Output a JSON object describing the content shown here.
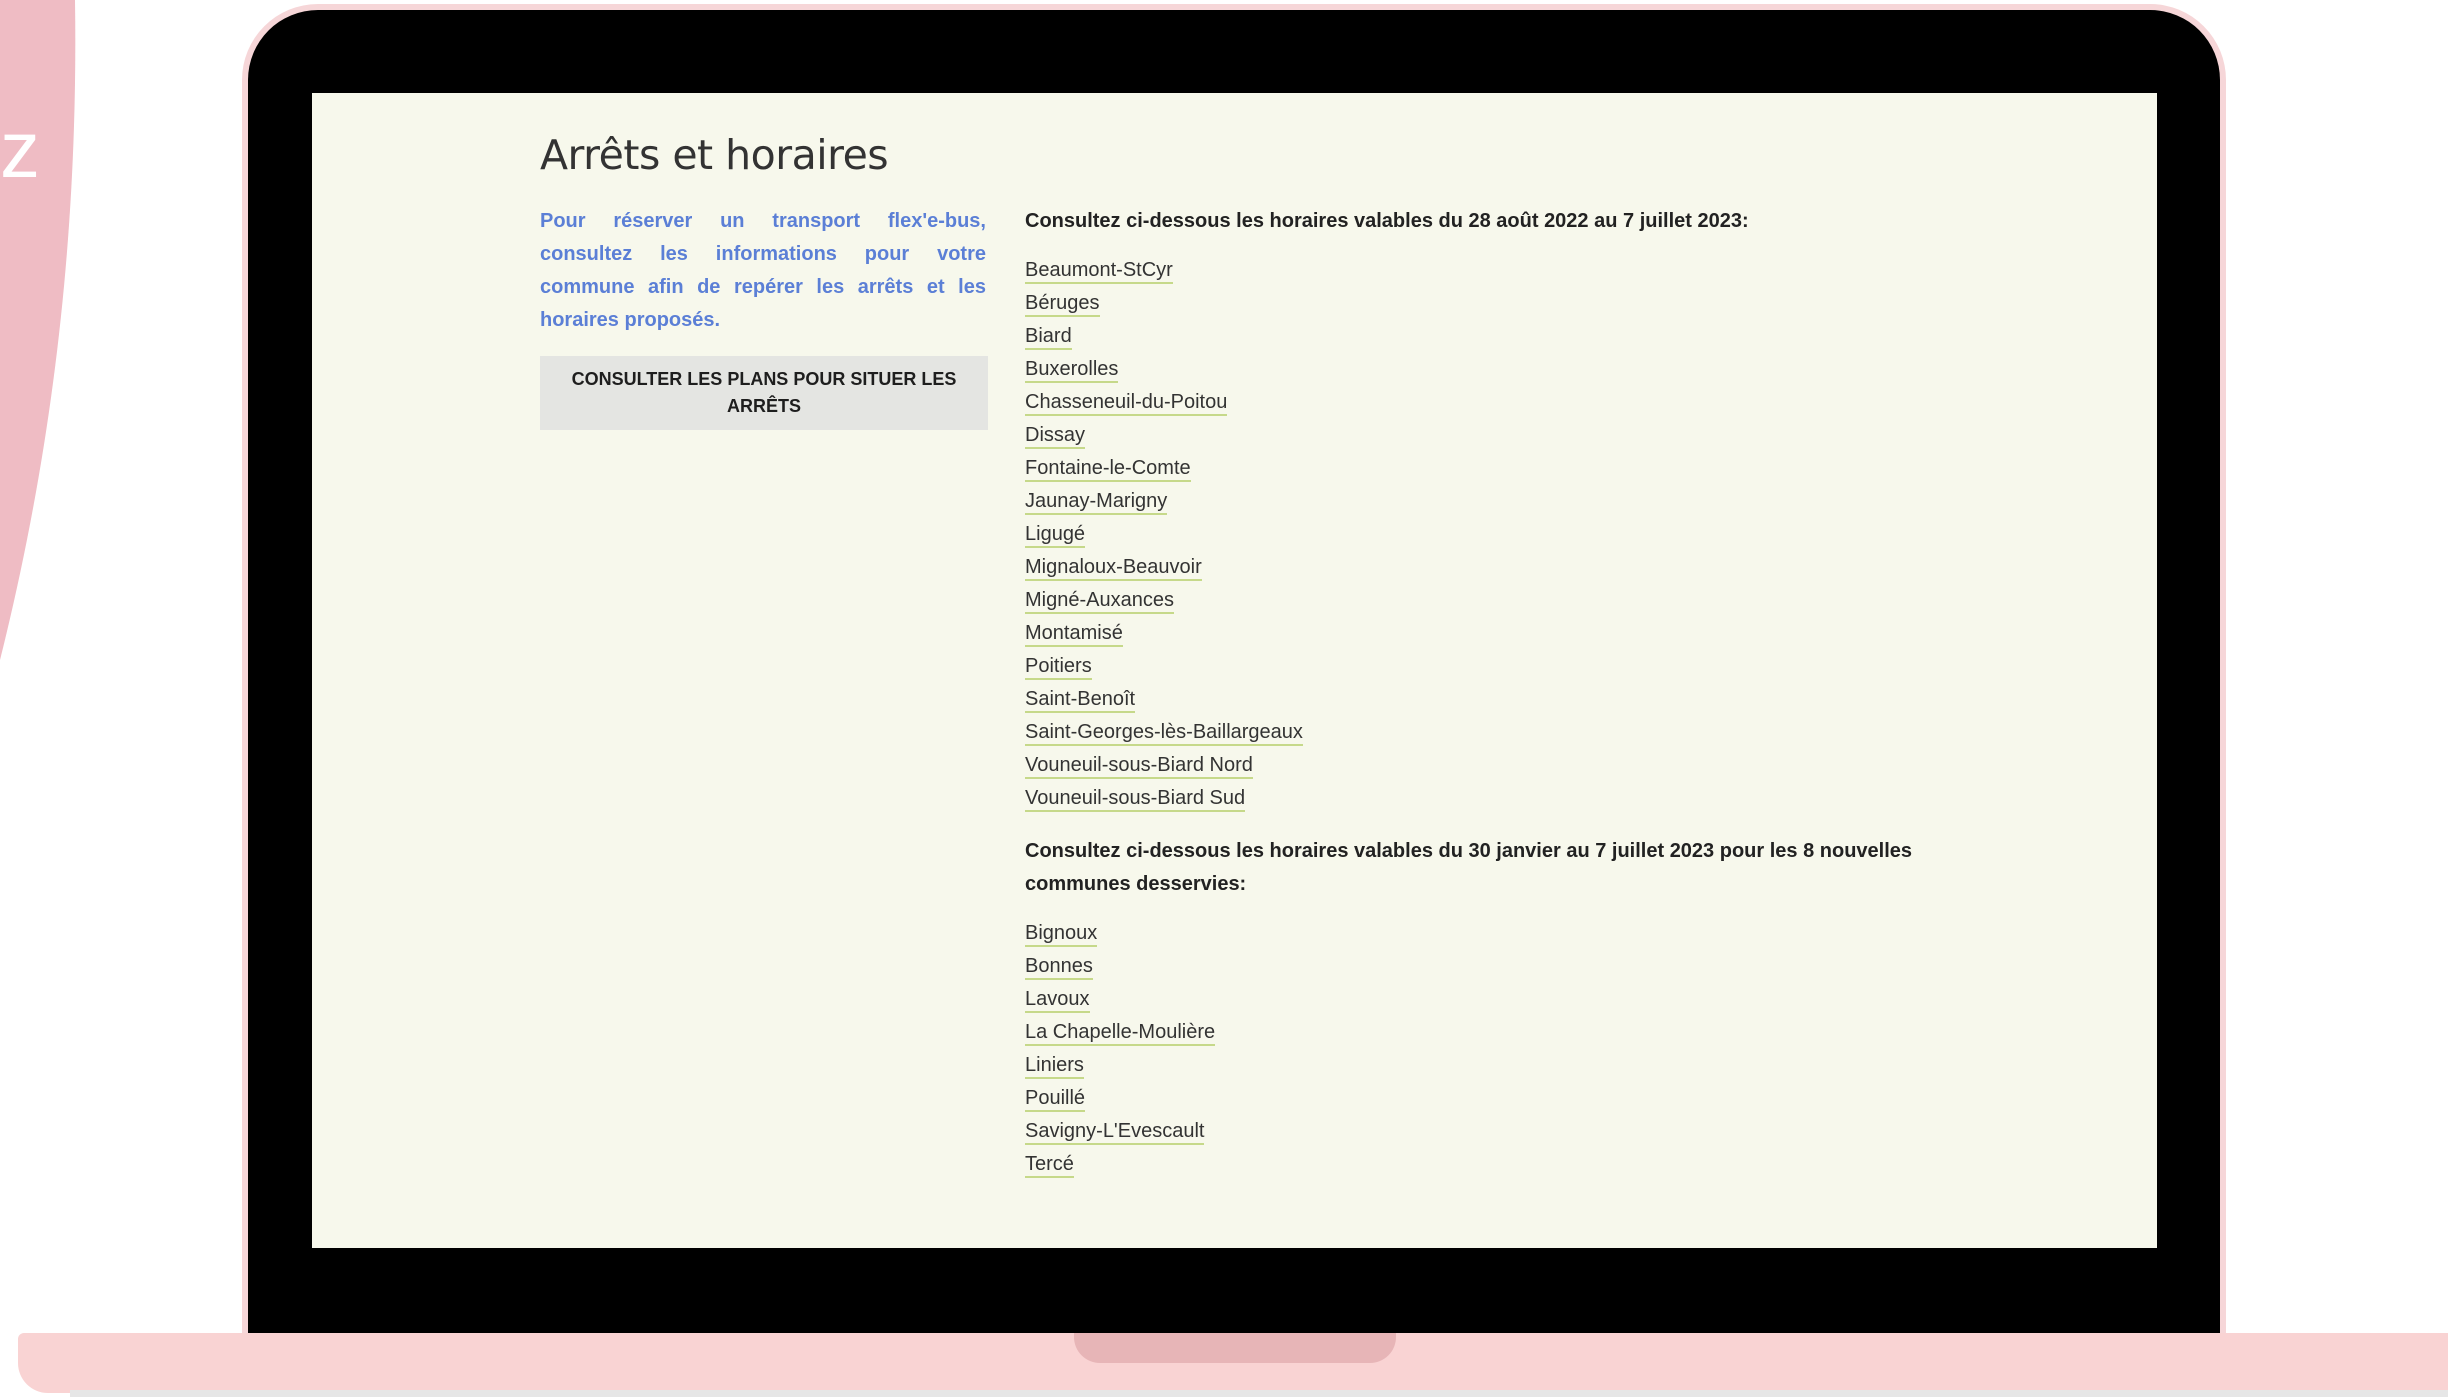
{
  "decor": {
    "bg_letter": "z"
  },
  "page": {
    "title": "Arrêts et horaires",
    "intro": "Pour réserver un transport flex'e-bus, consultez les informations pour votre commune afin de repérer les arrêts et les horaires proposés.",
    "plans_button": "CONSULTER LES PLANS POUR SITUER LES ARRÊTS"
  },
  "schedule_1": {
    "heading": "Consultez ci-dessous les horaires valables du 28 août 2022 au 7 juillet 2023:",
    "towns": [
      "Beaumont-StCyr",
      "Béruges",
      "Biard",
      "Buxerolles",
      "Chasseneuil-du-Poitou",
      "Dissay",
      "Fontaine-le-Comte",
      "Jaunay-Marigny",
      "Ligugé",
      "Mignaloux-Beauvoir",
      "Migné-Auxances",
      "Montamisé",
      "Poitiers",
      "Saint-Benoît",
      "Saint-Georges-lès-Baillargeaux",
      "Vouneuil-sous-Biard Nord",
      "Vouneuil-sous-Biard Sud"
    ]
  },
  "schedule_2": {
    "heading": "Consultez ci-dessous les horaires valables du 30 janvier au 7 juillet 2023 pour les 8 nouvelles communes desservies:",
    "towns": [
      "Bignoux",
      "Bonnes",
      "Lavoux",
      "La Chapelle-Moulière",
      "Liniers",
      "Pouillé",
      "Savigny-L'Evescault",
      "Tercé"
    ]
  },
  "colors": {
    "screen_bg": "#f7f8ec",
    "intro_text": "#5b7fd6",
    "link_underline": "#c6d98a",
    "laptop_pink": "#f9d3d3",
    "decor_pink": "#efbcc4"
  }
}
